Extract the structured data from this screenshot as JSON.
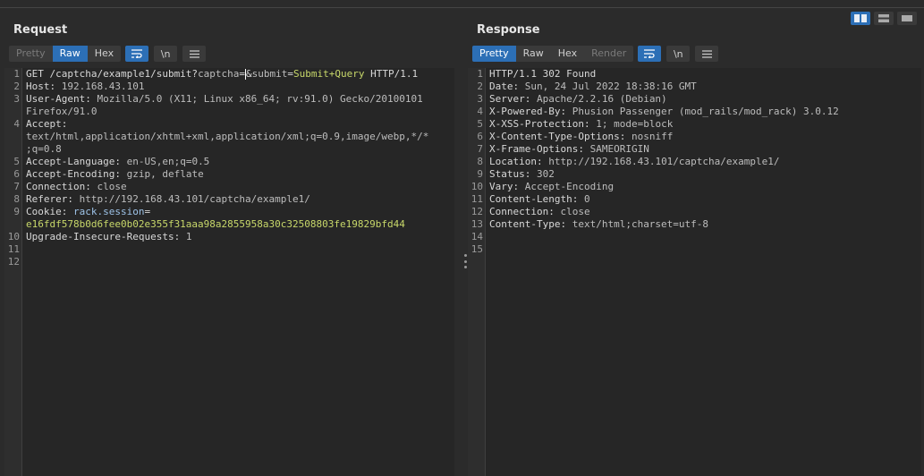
{
  "request": {
    "title": "Request",
    "tabs": [
      "Pretty",
      "Raw",
      "Hex"
    ],
    "active_tab": "Raw",
    "newline_label": "\\n",
    "lines": [
      {
        "n": "1",
        "parts": [
          {
            "t": "GET /captcha/example1/submit?",
            "c": "hn"
          },
          {
            "t": "captcha",
            "c": "pn"
          },
          {
            "t": "=",
            "c": "hn"
          },
          {
            "t": "",
            "c": "cursor"
          },
          {
            "t": "&",
            "c": "hn"
          },
          {
            "t": "submit",
            "c": "pn"
          },
          {
            "t": "=",
            "c": "hn"
          },
          {
            "t": "Submit+Query",
            "c": "pv"
          },
          {
            "t": " HTTP/1.1",
            "c": "hn"
          }
        ]
      },
      {
        "n": "2",
        "parts": [
          {
            "t": "Host: ",
            "c": "hn"
          },
          {
            "t": "192.168.43.101",
            "c": "hv"
          }
        ]
      },
      {
        "n": "3",
        "parts": [
          {
            "t": "User-Agent: ",
            "c": "hn"
          },
          {
            "t": "Mozilla/5.0 (X11; Linux x86_64; rv:91.0) Gecko/20100101",
            "c": "hv"
          }
        ]
      },
      {
        "n": "",
        "parts": [
          {
            "t": "Firefox/91.0",
            "c": "hv"
          }
        ]
      },
      {
        "n": "4",
        "parts": [
          {
            "t": "Accept: ",
            "c": "hn"
          }
        ]
      },
      {
        "n": "",
        "parts": [
          {
            "t": "text/html,application/xhtml+xml,application/xml;q=0.9,image/webp,*/*",
            "c": "hv"
          }
        ]
      },
      {
        "n": "",
        "parts": [
          {
            "t": ";q=0.8",
            "c": "hv"
          }
        ]
      },
      {
        "n": "5",
        "parts": [
          {
            "t": "Accept-Language: ",
            "c": "hn"
          },
          {
            "t": "en-US,en;q=0.5",
            "c": "hv"
          }
        ]
      },
      {
        "n": "6",
        "parts": [
          {
            "t": "Accept-Encoding: ",
            "c": "hn"
          },
          {
            "t": "gzip, deflate",
            "c": "hv"
          }
        ]
      },
      {
        "n": "7",
        "parts": [
          {
            "t": "Connection: ",
            "c": "hn"
          },
          {
            "t": "close",
            "c": "hv"
          }
        ]
      },
      {
        "n": "8",
        "parts": [
          {
            "t": "Referer: ",
            "c": "hn"
          },
          {
            "t": "http://192.168.43.101/captcha/example1/",
            "c": "hv"
          }
        ]
      },
      {
        "n": "9",
        "parts": [
          {
            "t": "Cookie: ",
            "c": "hn"
          },
          {
            "t": "rack.session",
            "c": "ck"
          },
          {
            "t": "=",
            "c": "hn"
          }
        ]
      },
      {
        "n": "",
        "parts": [
          {
            "t": "e16fdf578b0d6fee0b02e355f31aaa98a2855958a30c32508803fe19829bfd44",
            "c": "cv"
          }
        ]
      },
      {
        "n": "10",
        "parts": [
          {
            "t": "Upgrade-Insecure-Requests: ",
            "c": "hn"
          },
          {
            "t": "1",
            "c": "hv"
          }
        ]
      },
      {
        "n": "11",
        "parts": []
      },
      {
        "n": "12",
        "parts": []
      }
    ]
  },
  "response": {
    "title": "Response",
    "tabs": [
      "Pretty",
      "Raw",
      "Hex",
      "Render"
    ],
    "active_tab": "Pretty",
    "newline_label": "\\n",
    "lines": [
      {
        "n": "1",
        "parts": [
          {
            "t": "HTTP/1.1 302 Found",
            "c": "hn"
          }
        ]
      },
      {
        "n": "2",
        "parts": [
          {
            "t": "Date: ",
            "c": "hn"
          },
          {
            "t": "Sun, 24 Jul 2022 18:38:16 GMT",
            "c": "hv"
          }
        ]
      },
      {
        "n": "3",
        "parts": [
          {
            "t": "Server: ",
            "c": "hn"
          },
          {
            "t": "Apache/2.2.16 (Debian)",
            "c": "hv"
          }
        ]
      },
      {
        "n": "4",
        "parts": [
          {
            "t": "X-Powered-By: ",
            "c": "hn"
          },
          {
            "t": "Phusion Passenger (mod_rails/mod_rack) 3.0.12",
            "c": "hv"
          }
        ]
      },
      {
        "n": "5",
        "parts": [
          {
            "t": "X-XSS-Protection: ",
            "c": "hn"
          },
          {
            "t": "1; mode=block",
            "c": "hv"
          }
        ]
      },
      {
        "n": "6",
        "parts": [
          {
            "t": "X-Content-Type-Options: ",
            "c": "hn"
          },
          {
            "t": "nosniff",
            "c": "hv"
          }
        ]
      },
      {
        "n": "7",
        "parts": [
          {
            "t": "X-Frame-Options: ",
            "c": "hn"
          },
          {
            "t": "SAMEORIGIN",
            "c": "hv"
          }
        ]
      },
      {
        "n": "8",
        "parts": [
          {
            "t": "Location: ",
            "c": "hn"
          },
          {
            "t": "http://192.168.43.101/captcha/example1/",
            "c": "hv"
          }
        ]
      },
      {
        "n": "9",
        "parts": [
          {
            "t": "Status: ",
            "c": "hn"
          },
          {
            "t": "302",
            "c": "hv"
          }
        ]
      },
      {
        "n": "10",
        "parts": [
          {
            "t": "Vary: ",
            "c": "hn"
          },
          {
            "t": "Accept-Encoding",
            "c": "hv"
          }
        ]
      },
      {
        "n": "11",
        "parts": [
          {
            "t": "Content-Length: ",
            "c": "hn"
          },
          {
            "t": "0",
            "c": "hv"
          }
        ]
      },
      {
        "n": "12",
        "parts": [
          {
            "t": "Connection: ",
            "c": "hn"
          },
          {
            "t": "close",
            "c": "hv"
          }
        ]
      },
      {
        "n": "13",
        "parts": [
          {
            "t": "Content-Type: ",
            "c": "hn"
          },
          {
            "t": "text/html;charset=utf-8",
            "c": "hv"
          }
        ]
      },
      {
        "n": "14",
        "parts": []
      },
      {
        "n": "15",
        "parts": []
      }
    ]
  },
  "colors": {
    "accent": "#2c6fb6",
    "background": "#2b2b2b",
    "editor": "#262626"
  },
  "icons": [
    "layout-side-by-side-icon",
    "layout-stacked-icon",
    "layout-tabs-icon",
    "word-wrap-icon",
    "menu-icon"
  ]
}
